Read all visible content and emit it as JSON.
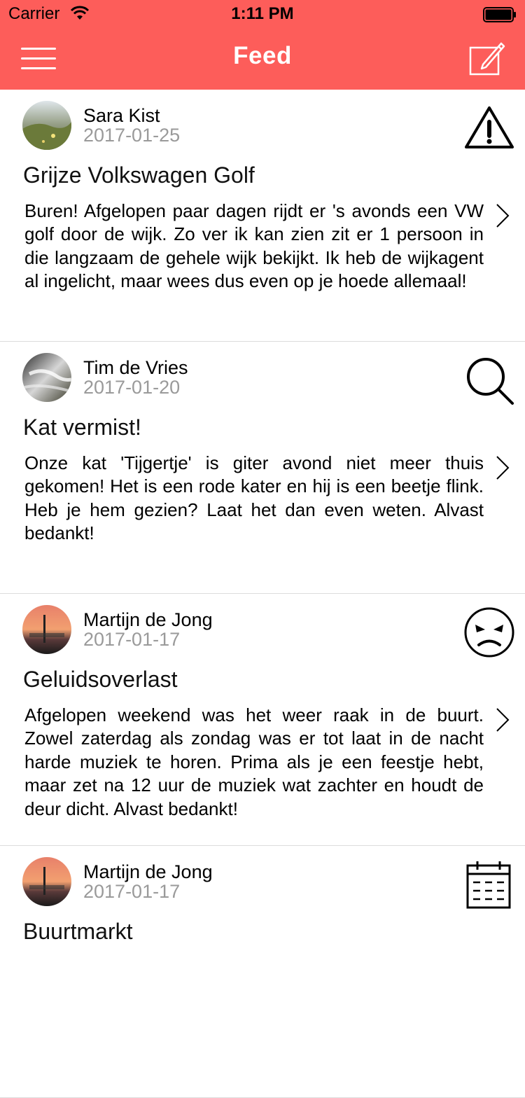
{
  "status_bar": {
    "carrier": "Carrier",
    "time": "1:11 PM"
  },
  "nav": {
    "title": "Feed",
    "menu_icon": "hamburger-menu-icon",
    "compose_icon": "compose-icon"
  },
  "colors": {
    "accent": "#fd5d5a",
    "date_gray": "#9a9a9a",
    "divider": "#dcdcdc"
  },
  "posts": [
    {
      "author": "Sara Kist",
      "date": "2017-01-25",
      "title": "Grijze Volkswagen Golf",
      "body": "Buren! Afgelopen paar dagen rijdt er 's avonds een VW golf door de wijk. Zo ver ik kan zien zit er 1 persoon in die langzaam de gehele wijk bekijkt. Ik heb de wijkagent al ingelicht, maar wees dus even op je hoede allemaal!",
      "icon": "warning-icon"
    },
    {
      "author": "Tim de Vries",
      "date": "2017-01-20",
      "title": "Kat vermist!",
      "body": "Onze kat 'Tijgertje' is giter avond niet meer thuis gekomen! Het is een rode kater en hij is een beetje flink. Heb je hem gezien? Laat het dan even weten. Alvast bedankt!",
      "icon": "search-icon"
    },
    {
      "author": "Martijn de Jong",
      "date": "2017-01-17",
      "title": "Geluidsoverlast",
      "body": "Afgelopen weekend was het weer raak in de buurt. Zowel zaterdag als zondag was er tot laat in de nacht harde muziek te horen. Prima als je een feestje hebt, maar zet na 12 uur de muziek wat zachter en houdt de deur dicht. Alvast bedankt!",
      "icon": "angry-face-icon"
    },
    {
      "author": "Martijn de Jong",
      "date": "2017-01-17",
      "title": "Buurtmarkt",
      "body": "",
      "icon": "calendar-icon"
    }
  ]
}
